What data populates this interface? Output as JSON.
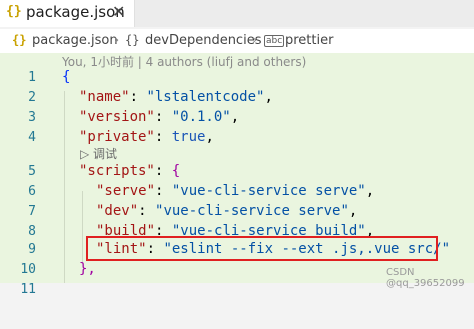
{
  "tab": {
    "icon": "{}",
    "label": "package.json",
    "close": "✕"
  },
  "breadcrumb": {
    "file_icon": "{}",
    "file": "package.json",
    "sep1": "›",
    "obj_icon": "{}",
    "section": "devDependencies",
    "sep2": "›",
    "prop_icon": "abc",
    "prop": "prettier"
  },
  "editor": {
    "blame": "You, 1小时前 | 4 authors (liufj and others)",
    "codelens": "▷ 调试",
    "lines": [
      {
        "n": "1",
        "text": "{"
      },
      {
        "n": "2",
        "key": "\"name\"",
        "value": "\"lstalentcode\""
      },
      {
        "n": "3",
        "key": "\"version\"",
        "value": "\"0.1.0\""
      },
      {
        "n": "4",
        "key": "\"private\"",
        "value": "true"
      },
      {
        "n": "5",
        "key": "\"scripts\"",
        "value": "{"
      },
      {
        "n": "6",
        "key": "\"serve\"",
        "value": "\"vue-cli-service serve\""
      },
      {
        "n": "7",
        "key": "\"dev\"",
        "value": "\"vue-cli-service serve\""
      },
      {
        "n": "8",
        "key": "\"build\"",
        "value": "\"vue-cli-service build\""
      },
      {
        "n": "9",
        "key": "\"lint\"",
        "value": "\"eslint --fix --ext .js,.vue src/\""
      },
      {
        "n": "10",
        "text": "},"
      },
      {
        "n": "11",
        "text": ""
      }
    ]
  },
  "watermark": "CSDN @qq_39652099"
}
